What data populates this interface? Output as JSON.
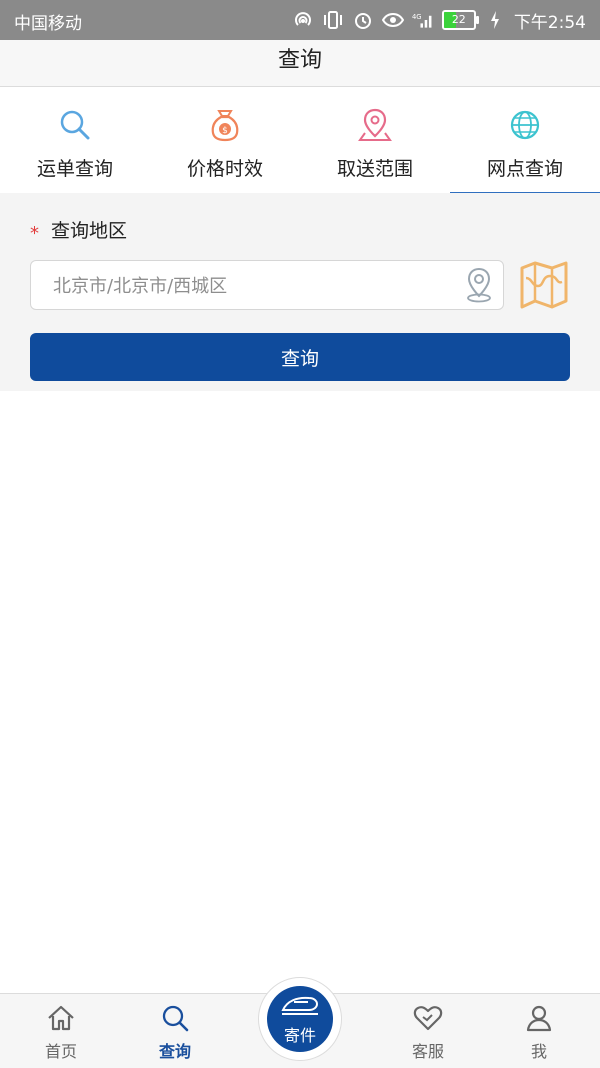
{
  "status_bar": {
    "carrier": "中国移动",
    "battery": "22",
    "time": "下午2:54",
    "icons": [
      "hotspot-icon",
      "vibrate-icon",
      "alarm-icon",
      "eye-icon",
      "4g-signal-icon",
      "charging-icon"
    ]
  },
  "header": {
    "title": "查询"
  },
  "tabs": [
    {
      "label": "运单查询",
      "icon": "search-icon",
      "active": false
    },
    {
      "label": "价格时效",
      "icon": "money-bag-icon",
      "active": false
    },
    {
      "label": "取送范围",
      "icon": "map-pin-icon",
      "active": false
    },
    {
      "label": "网点查询",
      "icon": "globe-icon",
      "active": true
    }
  ],
  "form": {
    "required_mark": "*",
    "field_label": "查询地区",
    "region_input": {
      "value": "",
      "placeholder": "北京市/北京市/西城区"
    },
    "submit_label": "查询"
  },
  "bottom_nav": {
    "items": [
      {
        "label": "首页",
        "icon": "home-icon",
        "active": false
      },
      {
        "label": "查询",
        "icon": "search-icon",
        "active": true
      },
      {
        "label": "客服",
        "icon": "handshake-heart-icon",
        "active": false
      },
      {
        "label": "我",
        "icon": "person-icon",
        "active": false
      }
    ],
    "center": {
      "label": "寄件",
      "icon": "train-icon"
    }
  },
  "colors": {
    "primary": "#0f4b9c",
    "active_tab_underline": "#2f6fbf",
    "required": "#e23b3b",
    "map_icon": "#f0b56a"
  }
}
